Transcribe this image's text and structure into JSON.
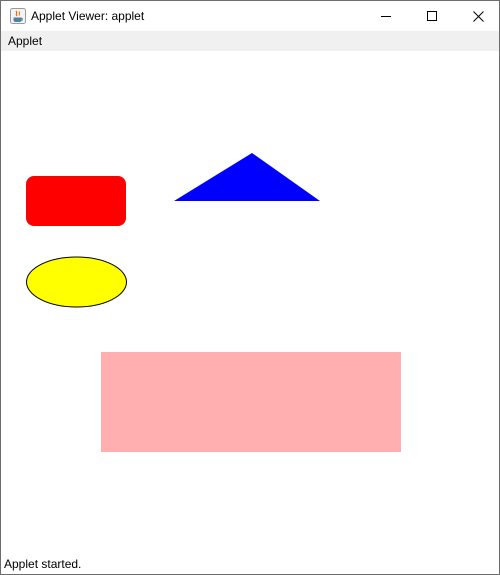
{
  "window": {
    "title": "Applet Viewer: applet"
  },
  "menubar": {
    "items": [
      {
        "label": "Applet"
      }
    ]
  },
  "status": {
    "text": "Applet started."
  },
  "colors": {
    "red_rect": "#ff0000",
    "blue_triangle": "#0000ff",
    "yellow_oval": "#ffff00",
    "oval_outline": "#000000",
    "pink_rect": "#ffafaf"
  },
  "icons": {
    "app": "java-icon",
    "minimize": "minimize-icon",
    "maximize": "maximize-icon",
    "close": "close-icon"
  }
}
